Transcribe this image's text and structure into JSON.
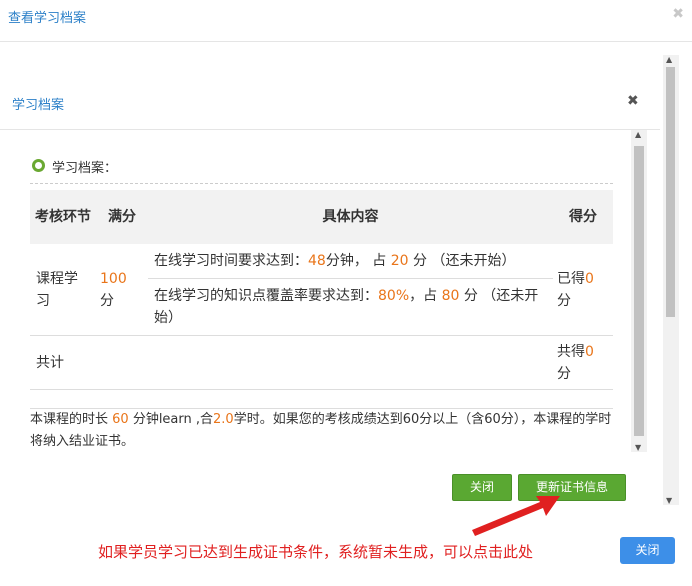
{
  "outer": {
    "title": "查看学习档案",
    "close_label": "关闭"
  },
  "inner": {
    "title": "学习档案"
  },
  "section": {
    "label": "学习档案："
  },
  "table": {
    "headers": [
      "考核环节",
      "满分",
      "具体内容",
      "得分"
    ],
    "row1": {
      "name": "课程学习",
      "full_score": "100分",
      "req1_prefix": "在线学习时间要求达到：",
      "req1_value": "48",
      "req1_mid": "分钟，  占 ",
      "req1_pct": "20",
      "req1_suffix": " 分 （还未开始）",
      "req2_prefix": "在线学习的知识点覆盖率要求达到：",
      "req2_value": "80%",
      "req2_mid": "，占 ",
      "req2_pct": "80",
      "req2_suffix": " 分 （还未开始）",
      "score_prefix": "已得",
      "score_value": "0",
      "score_suffix": "分"
    },
    "total": {
      "label": "共计",
      "score_prefix": "共得",
      "score_value": "0",
      "score_suffix": "分"
    }
  },
  "note": {
    "p1": "本课程的时长 ",
    "minutes": "60",
    "p2": " 分钟learn ,合",
    "hours": "2.0",
    "p3": "学时。如果您的考核成绩达到60分以上（含60分），本课程的学时将纳入结业证书。"
  },
  "buttons": {
    "close": "关闭",
    "update_cert": "更新证书信息"
  },
  "annotation": "如果学员学习已达到生成证书条件，系统暂未生成，可以点击此处"
}
